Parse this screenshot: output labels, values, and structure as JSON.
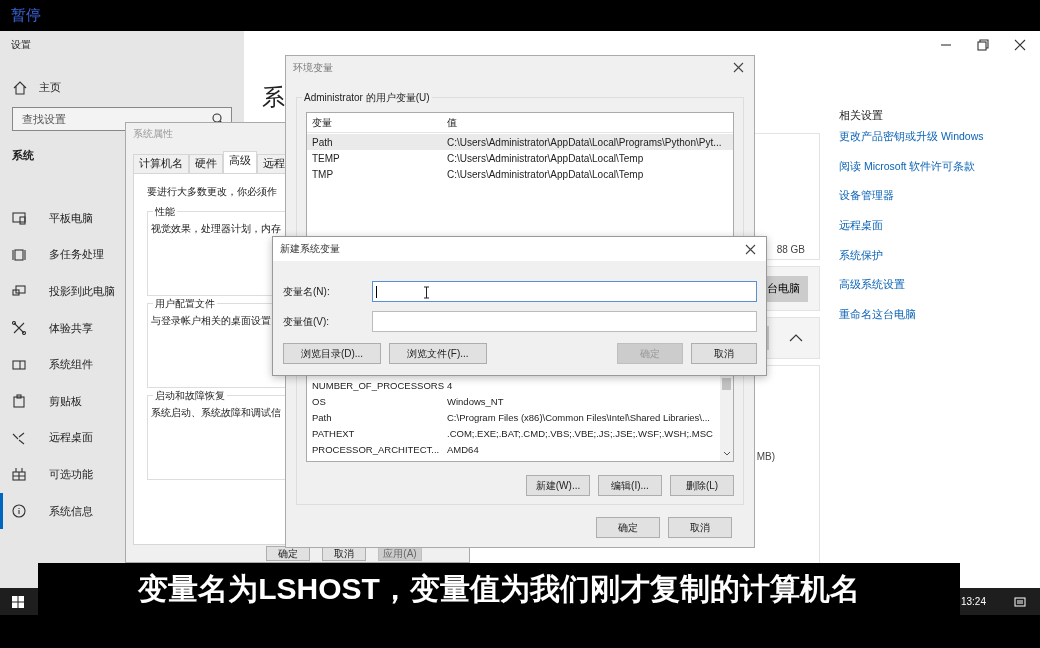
{
  "player": {
    "status": "暂停"
  },
  "settings": {
    "title": "设置",
    "home": "主页",
    "search_placeholder": "查找设置",
    "section": "系统",
    "nav": [
      {
        "label": "平板电脑",
        "selected": false
      },
      {
        "label": "多任务处理",
        "selected": false
      },
      {
        "label": "投影到此电脑",
        "selected": false
      },
      {
        "label": "体验共享",
        "selected": false
      },
      {
        "label": "系统组件",
        "selected": false
      },
      {
        "label": "剪贴板",
        "selected": false
      },
      {
        "label": "远程桌面",
        "selected": false
      },
      {
        "label": "可选功能",
        "selected": false
      },
      {
        "label": "系统信息",
        "selected": true
      }
    ],
    "heading": "系",
    "cards": [
      {
        "kind": "text",
        "text": "88 GB"
      },
      {
        "kind": "button",
        "text": "台电脑"
      },
      {
        "kind": "chevron",
        "expanded": true
      },
      {
        "kind": "text",
        "text": "MB)"
      }
    ],
    "related": {
      "title": "相关设置",
      "links": [
        "更改产品密钥或升级 Windows",
        "阅读 Microsoft 软件许可条款",
        "设备管理器",
        "远程桌面",
        "系统保护",
        "高级系统设置",
        "重命名这台电脑"
      ]
    }
  },
  "system_properties": {
    "title": "系统属性",
    "tabs": [
      {
        "label": "计算机名",
        "selected": false
      },
      {
        "label": "硬件",
        "selected": false
      },
      {
        "label": "高级",
        "selected": true
      },
      {
        "label": "远程",
        "selected": false
      }
    ],
    "intro": "要进行大多数更改，你必须作",
    "groups": [
      {
        "title": "性能",
        "text": "视觉效果，处理器计划，内存"
      },
      {
        "title": "用户配置文件",
        "text": "与登录帐户相关的桌面设置"
      },
      {
        "title": "启动和故障恢复",
        "text": "系统启动、系统故障和调试信"
      }
    ],
    "buttons": [
      {
        "label": "确定",
        "disabled": false
      },
      {
        "label": "取消",
        "disabled": false
      },
      {
        "label": "应用(A)",
        "disabled": true
      }
    ]
  },
  "environment_variables": {
    "title": "环境变量",
    "user_group": "Administrator 的用户变量(U)",
    "columns": [
      "变量",
      "值"
    ],
    "user_rows": [
      {
        "name": "Path",
        "value": "C:\\Users\\Administrator\\AppData\\Local\\Programs\\Python\\Pyt...",
        "selected": true
      },
      {
        "name": "TEMP",
        "value": "C:\\Users\\Administrator\\AppData\\Local\\Temp",
        "selected": false
      },
      {
        "name": "TMP",
        "value": "C:\\Users\\Administrator\\AppData\\Local\\Temp",
        "selected": false
      }
    ],
    "system_rows": [
      {
        "name": "NUMBER_OF_PROCESSORS",
        "value": "4",
        "selected": false
      },
      {
        "name": "OS",
        "value": "Windows_NT",
        "selected": false
      },
      {
        "name": "Path",
        "value": "C:\\Program Files (x86)\\Common Files\\Intel\\Shared Libraries\\...",
        "selected": false
      },
      {
        "name": "PATHEXT",
        "value": ".COM;.EXE;.BAT;.CMD;.VBS;.VBE;.JS;.JSE;.WSF;.WSH;.MSC",
        "selected": false
      },
      {
        "name": "PROCESSOR_ARCHITECT...",
        "value": "AMD64",
        "selected": false
      }
    ],
    "system_buttons": [
      "新建(W)...",
      "编辑(I)...",
      "删除(L)"
    ],
    "buttons": [
      "确定",
      "取消"
    ]
  },
  "new_variable_dialog": {
    "title": "新建系统变量",
    "fields": [
      {
        "label": "变量名(N):",
        "focused": true
      },
      {
        "label": "变量值(V):",
        "focused": false
      }
    ],
    "buttons": [
      {
        "label": "浏览目录(D)...",
        "disabled": false
      },
      {
        "label": "浏览文件(F)...",
        "disabled": false
      },
      {
        "label": "确定",
        "disabled": true
      },
      {
        "label": "取消",
        "disabled": false
      }
    ]
  },
  "taskbar": {
    "time": "13:24"
  },
  "subtitle": "变量名为LSHOST，变量值为我们刚才复制的计算机名"
}
